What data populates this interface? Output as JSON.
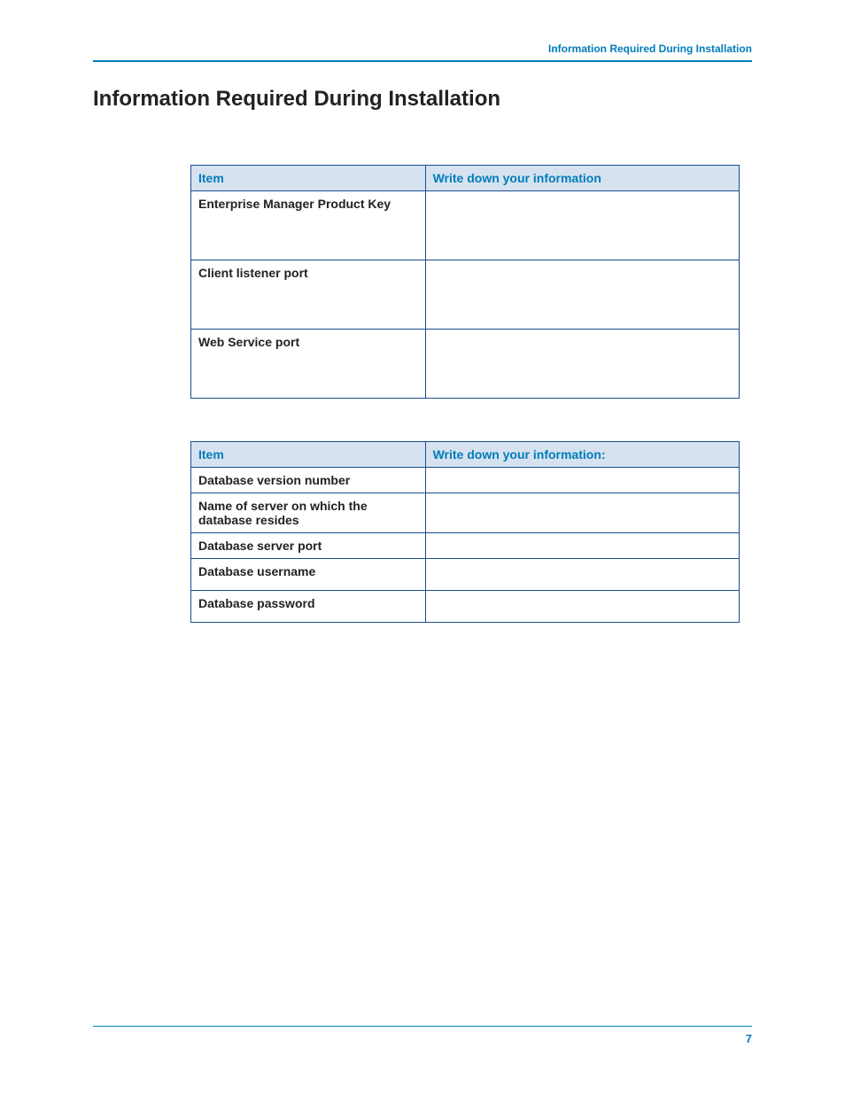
{
  "header": {
    "breadcrumb": "Information Required During Installation",
    "title": "Information Required During Installation"
  },
  "table1": {
    "headers": {
      "item": "Item",
      "info": "Write down your information"
    },
    "rows": [
      {
        "item": "Enterprise Manager Product Key",
        "value": ""
      },
      {
        "item": "Client listener port",
        "value": ""
      },
      {
        "item": "Web Service port",
        "value": ""
      }
    ]
  },
  "table2": {
    "headers": {
      "item": "Item",
      "info": "Write down your information:"
    },
    "rows": [
      {
        "item": "Database version number",
        "value": ""
      },
      {
        "item": "Name of server on which the database resides",
        "value": ""
      },
      {
        "item": "Database server port",
        "value": ""
      },
      {
        "item": "Database username",
        "value": ""
      },
      {
        "item": "Database password",
        "value": ""
      }
    ]
  },
  "footer": {
    "page_number": "7"
  }
}
